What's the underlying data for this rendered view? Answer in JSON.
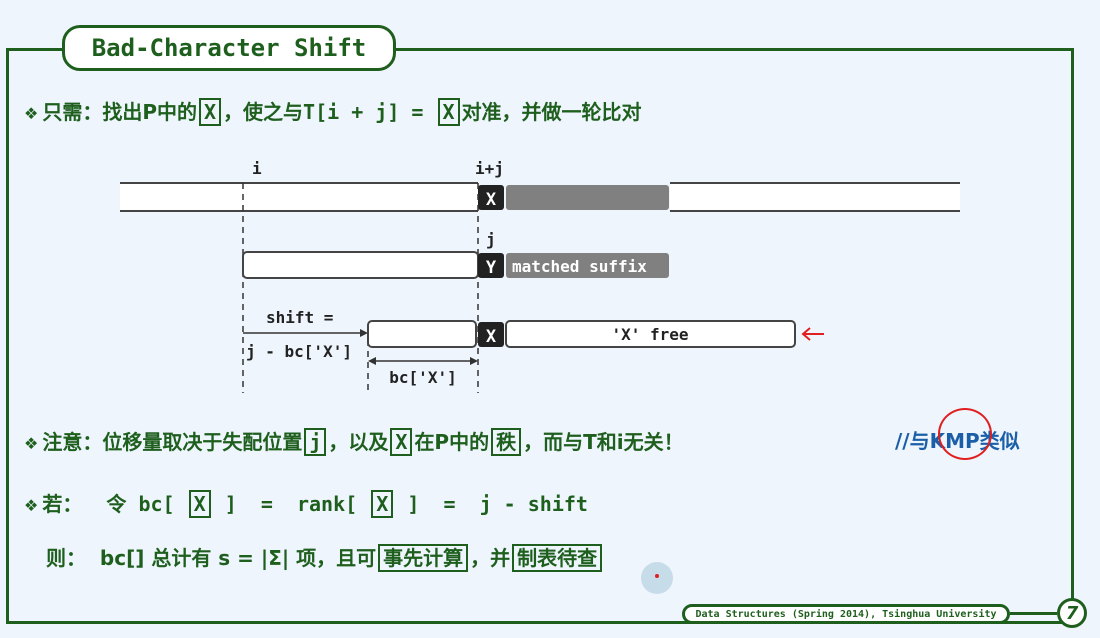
{
  "slide": {
    "title": "Bad-Character Shift",
    "line1": {
      "bullet": "❖",
      "prefix": "只需：找出P中的",
      "box1": "X",
      "mid": "，使之与T[i + j] = ",
      "box2": "X",
      "suffix": "对准，并做一轮比对"
    },
    "diagram": {
      "label_i": "i",
      "label_ij": "i+j",
      "label_j": "j",
      "text_x": "X",
      "pattern_y": "Y",
      "matched_suffix": "matched suffix",
      "shift_eq": "shift =",
      "shift_formula": "j - bc['X']",
      "bc_label": "bc['X']",
      "x_free": "'X' free"
    },
    "line2": {
      "bullet": "❖",
      "prefix": "注意：位移量取决于失配位置",
      "box1": "j",
      "mid": "，以及",
      "box2": "X",
      "mid2": "在P中的",
      "box3": "秩",
      "suffix": "，而与T和i无关！"
    },
    "note": "//与KMP类似",
    "line3": {
      "bullet": "❖",
      "prefix": "若：  令 bc[ ",
      "box1": "X",
      "mid": " ]  =  rank[ ",
      "box2": "X",
      "suffix": " ]  =  j - shift"
    },
    "line4": {
      "prefix": "则：  bc[] 总计有 s = |Σ| 项，且可",
      "box1": "事先计算",
      "mid": "，并",
      "box2": "制表待查"
    },
    "footer": "Data Structures (Spring 2014), Tsinghua University",
    "page_number": "7"
  }
}
